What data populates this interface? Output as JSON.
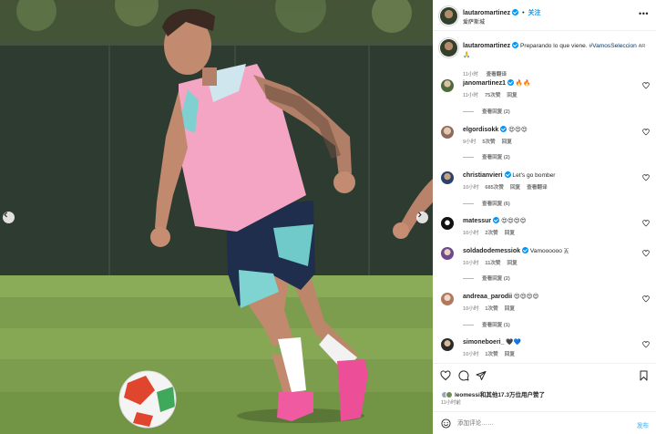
{
  "header": {
    "username": "lautaromartinez",
    "follow_label": "关注",
    "location": "爱萨斯城"
  },
  "caption": {
    "username": "lautaromartinez",
    "text": "Preparando lo que viene.",
    "hashtag": "#VamosSeleccion",
    "suffix": "AR",
    "time": "11小时",
    "translate": "查看翻译"
  },
  "comments": [
    {
      "username": "janomartinez1",
      "text": "🔥🔥",
      "time": "11小时",
      "likes": "75次赞",
      "reply": "回复",
      "view_replies": "查看回复 (2)"
    },
    {
      "username": "elgordisokk",
      "text": "😍😍😍",
      "time": "9小时",
      "likes": "5次赞",
      "reply": "回复",
      "view_replies": "查看回复 (2)"
    },
    {
      "username": "christianvieri",
      "text": "Let's go bomber",
      "time": "10小时",
      "likes": "685次赞",
      "reply": "回复",
      "translate": "查看翻译",
      "view_replies": "查看回复 (6)"
    },
    {
      "username": "matessur",
      "text": "😍😍😍😍",
      "time": "10小时",
      "likes": "2次赞",
      "reply": "回复"
    },
    {
      "username": "soldadodemessiok",
      "text": "Vamoooooo 🇦",
      "time": "10小时",
      "likes": "11次赞",
      "reply": "回复",
      "view_replies": "查看回复 (2)"
    },
    {
      "username": "andreaa_parodii",
      "text": "😍😍😍😍",
      "time": "10小时",
      "likes": "1次赞",
      "reply": "回复",
      "view_replies": "查看回复 (1)"
    },
    {
      "username": "simoneboeri_",
      "text": "🖤💙",
      "time": "10小时",
      "likes": "1次赞",
      "reply": "回复"
    }
  ],
  "likes_line": "leomessi和其他17.3万位用户赞了",
  "post_time": "11小时前",
  "add_comment": {
    "placeholder": "添加评论……",
    "post_label": "发布"
  },
  "colors": {
    "accent": "#0095f6",
    "bib": "#f4a6c2",
    "grass": "#7e9f50"
  },
  "icons": [
    "heart-icon",
    "comment-icon",
    "share-icon",
    "bookmark-icon",
    "more-icon",
    "emoji-icon",
    "chevron-left-icon",
    "chevron-right-icon"
  ]
}
